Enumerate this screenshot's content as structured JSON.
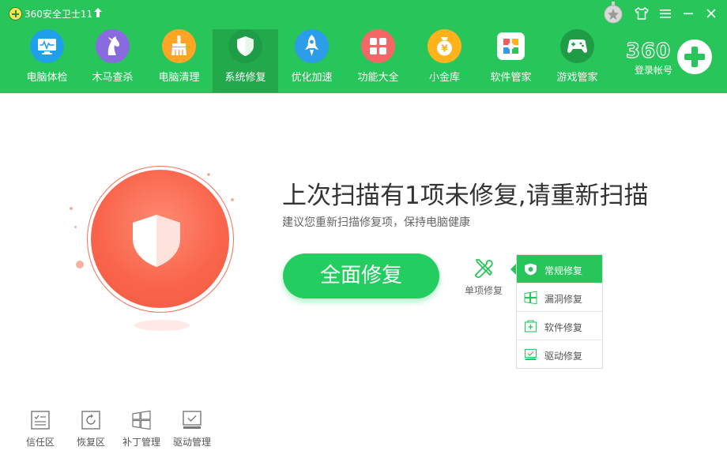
{
  "app": {
    "title": "360安全卫士11"
  },
  "nav": {
    "items": [
      {
        "label": "电脑体检",
        "icon": "monitor-icon",
        "color": "#1fa0e8"
      },
      {
        "label": "木马查杀",
        "icon": "horse-icon",
        "color": "#8a6adf"
      },
      {
        "label": "电脑清理",
        "icon": "broom-icon",
        "color": "#ffa526"
      },
      {
        "label": "系统修复",
        "icon": "shield-icon",
        "color": "#1e9c46",
        "active": true
      },
      {
        "label": "优化加速",
        "icon": "rocket-icon",
        "color": "#2c9de8"
      },
      {
        "label": "功能大全",
        "icon": "grid-icon",
        "color": "#f56666"
      },
      {
        "label": "小金库",
        "icon": "money-bag-icon",
        "color": "#ffb21a"
      },
      {
        "label": "软件管家",
        "icon": "apps-icon",
        "color": "#ffffff"
      },
      {
        "label": "游戏管家",
        "icon": "gamepad-icon",
        "color": "#1e9c46"
      }
    ]
  },
  "account": {
    "logo_text": "360",
    "login_label": "登录帐号"
  },
  "main": {
    "headline": "上次扫描有1项未修复,请重新扫描",
    "subline": "建议您重新扫描修复项，保持电脑健康",
    "repair_button": "全面修复",
    "single_repair_label": "单项修复"
  },
  "repair_menu": {
    "items": [
      {
        "label": "常规修复",
        "icon": "shield-icon",
        "active": true
      },
      {
        "label": "漏洞修复",
        "icon": "windows-icon"
      },
      {
        "label": "软件修复",
        "icon": "package-icon"
      },
      {
        "label": "驱动修复",
        "icon": "driver-icon"
      }
    ]
  },
  "bottom_tools": {
    "items": [
      {
        "label": "信任区",
        "icon": "trust-list-icon"
      },
      {
        "label": "恢复区",
        "icon": "restore-icon"
      },
      {
        "label": "补丁管理",
        "icon": "windows-patch-icon"
      },
      {
        "label": "驱动管理",
        "icon": "driver-check-icon"
      }
    ]
  },
  "colors": {
    "brand_green": "#28c65a",
    "button_green": "#24cd60",
    "shield_red": "#f9664d"
  }
}
